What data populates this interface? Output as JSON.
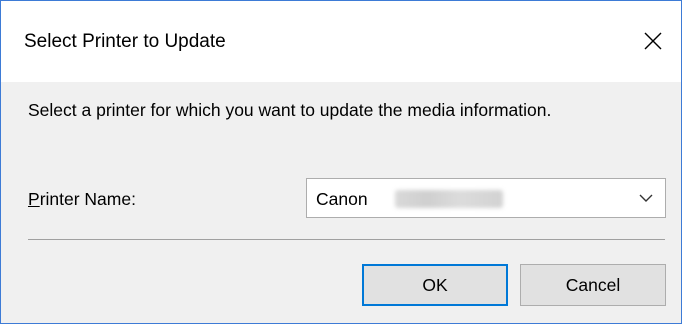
{
  "dialog": {
    "title": "Select Printer to Update",
    "message": "Select a printer for which you want to update the media information.",
    "printer_label": {
      "mnemonic": "P",
      "rest": "rinter Name:"
    },
    "printer_select": {
      "value": "Canon"
    },
    "buttons": {
      "ok_label": "OK",
      "cancel_label": "Cancel"
    }
  },
  "icons": {
    "close": "close-icon",
    "dropdown": "chevron-down-icon"
  },
  "colors": {
    "window_border": "#3d7bd6",
    "default_button_border": "#0078d7",
    "button_face": "#e1e1e1",
    "dialog_background": "#f0f0f0"
  }
}
